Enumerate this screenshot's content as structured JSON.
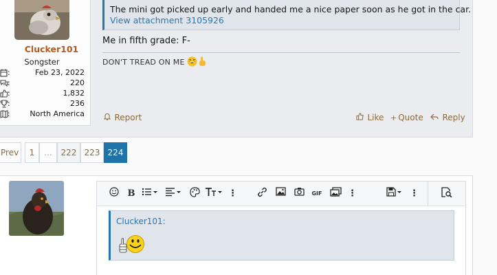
{
  "post": {
    "user": {
      "name": "Clucker101",
      "title": "Songster",
      "stats": [
        {
          "icon": "calendar-icon",
          "value": "Feb 23, 2022"
        },
        {
          "icon": "messages-icon",
          "value": "220"
        },
        {
          "icon": "thumbs-up-icon",
          "value": "1,832"
        },
        {
          "icon": "trophy-icon",
          "value": "236"
        },
        {
          "icon": "map-icon",
          "value": "North America"
        }
      ]
    },
    "quote_text": "The mini got picked up early and handed me a nice paper soon as he got in the car.",
    "quote_link": "View attachment 3105926",
    "body": "Me in fifth grade: F-",
    "signature": "DON'T TREAD ON ME",
    "actions": {
      "report": "Report",
      "like": "Like",
      "quote": "Quote",
      "reply": "Reply"
    }
  },
  "pagination": {
    "prev": "Prev",
    "pages": [
      "1",
      "…",
      "222",
      "223",
      "224"
    ],
    "current": "224"
  },
  "editor": {
    "quote_author": "Clucker101:"
  },
  "colors": {
    "accent": "#2577b1",
    "link_brown": "#8a6b3b",
    "username": "#b35a1f",
    "page_current": "#1e73a8"
  }
}
